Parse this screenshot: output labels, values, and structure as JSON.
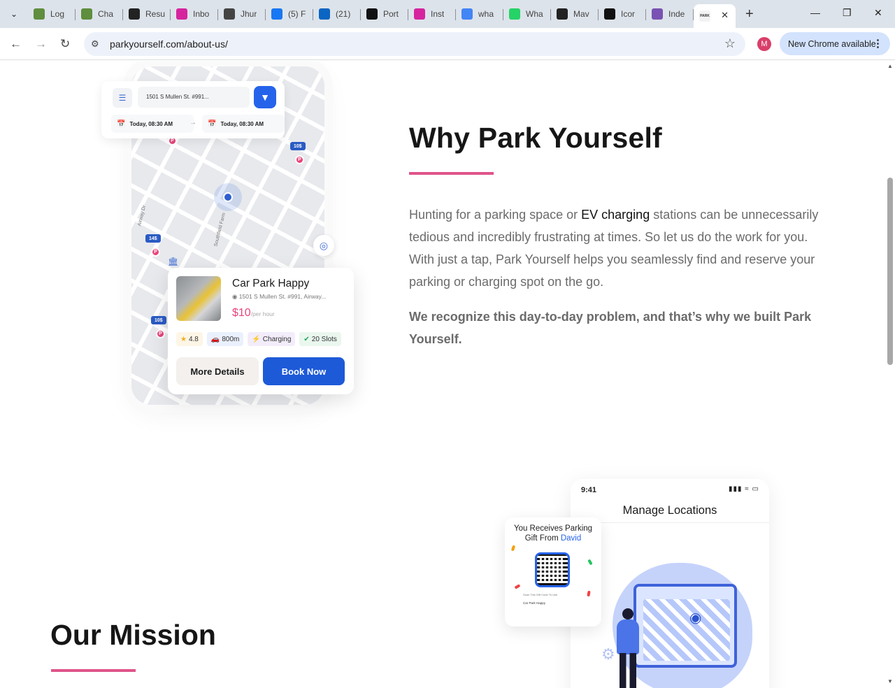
{
  "browser": {
    "tabs": [
      {
        "title": "Log",
        "icon": "shopify-icon",
        "color": "#5e8e3e"
      },
      {
        "title": "Cha",
        "icon": "shopify-icon",
        "color": "#5e8e3e"
      },
      {
        "title": "Resu",
        "icon": "slash-icon",
        "color": "#222222"
      },
      {
        "title": "Inbo",
        "icon": "instagram-icon",
        "color": "#d6249f"
      },
      {
        "title": "Jhur",
        "icon": "rs-icon",
        "color": "#444444"
      },
      {
        "title": "(5) F",
        "icon": "facebook-icon",
        "color": "#1877f2"
      },
      {
        "title": "(21)",
        "icon": "linkedin-icon",
        "color": "#0a66c2"
      },
      {
        "title": "Port",
        "icon": "openai-icon",
        "color": "#111111"
      },
      {
        "title": "Inst",
        "icon": "instagram-icon",
        "color": "#d6249f"
      },
      {
        "title": "wha",
        "icon": "google-icon",
        "color": "#4285f4"
      },
      {
        "title": "Wha",
        "icon": "whatsapp-icon",
        "color": "#25d366"
      },
      {
        "title": "Mav",
        "icon": "slash-icon",
        "color": "#222222"
      },
      {
        "title": "Icor",
        "icon": "openai-icon",
        "color": "#111111"
      },
      {
        "title": "Inde",
        "icon": "bootstrap-icon",
        "color": "#7952b3"
      }
    ],
    "active_tab_icon": "park-yourself-icon",
    "url": "parkyourself.com/about-us/",
    "profile_initial": "M",
    "update_label": "New Chrome available"
  },
  "app_card": {
    "address": "1501 S Mullen St. #991...",
    "date_from": "Today, 08:30 AM",
    "date_to": "Today, 08:30 AM",
    "map_prices": [
      "10$",
      "14$",
      "10$"
    ],
    "street_1": "Airway Dr",
    "street_2": "Southfield Farm",
    "parking_name": "Car Park Happy",
    "parking_address": "1501 S Mullen St. #991, Airway...",
    "price": "$10",
    "price_unit": "/per hour",
    "rating": "4.8",
    "distance": "800m",
    "charging": "Charging",
    "slots": "20 Slots",
    "more_details": "More Details",
    "book_now": "Book Now"
  },
  "why": {
    "title": "Why Park Yourself",
    "body_before": "Hunting for a parking space or ",
    "body_link": "EV charging",
    "body_after": " stations can be unnecessarily tedious and incredibly frustrating at times. So let us do the work for you. With just a tap, Park Yourself helps you seamlessly find and reserve your parking or charging spot on the go.",
    "strong": "We recognize this day-to-day problem, and that’s why we built Park Yourself."
  },
  "mission": {
    "title": "Our Mission"
  },
  "manage_phone": {
    "time": "9:41",
    "title": "Manage Locations"
  },
  "gift_card": {
    "line1": "You Receives Parking",
    "line2_prefix": "Gift From ",
    "name": "David",
    "qr_caption": "Scan This Gift Code To Use",
    "mini_title": "Car Park Happy"
  },
  "colors": {
    "accent": "#e0548a",
    "primary_blue": "#1d5ad8",
    "pin_pink": "#e8447a"
  }
}
